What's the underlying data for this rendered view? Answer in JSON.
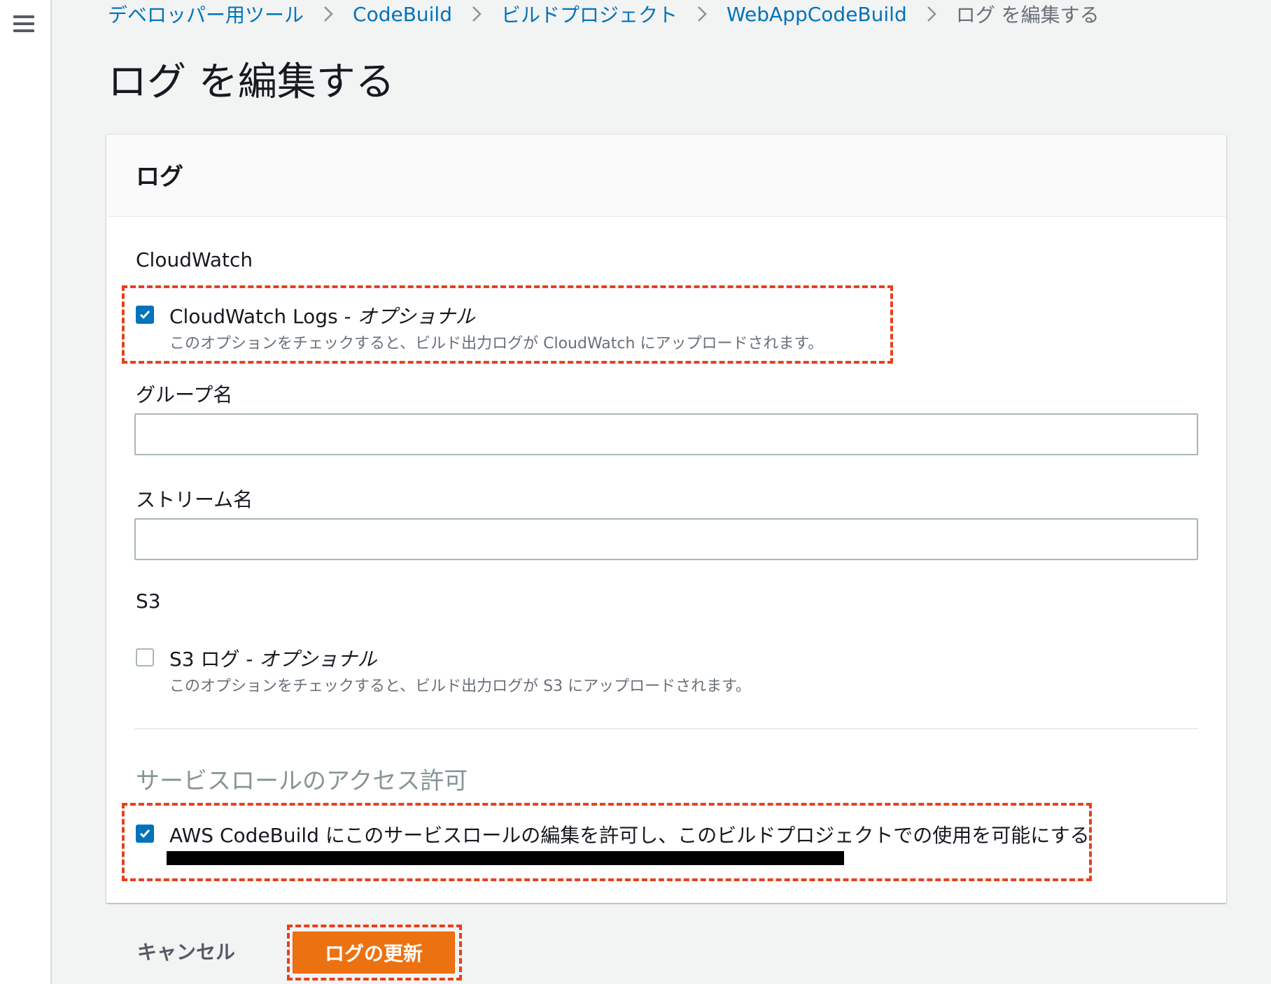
{
  "breadcrumb": [
    {
      "label": "デベロッパー用ツール"
    },
    {
      "label": "CodeBuild"
    },
    {
      "label": "ビルドプロジェクト"
    },
    {
      "label": "WebAppCodeBuild"
    },
    {
      "label": "ログ を編集する"
    }
  ],
  "page_title": "ログ を編集する",
  "panel": {
    "title": "ログ",
    "cloudwatch": {
      "section_label": "CloudWatch",
      "logs_checkbox": {
        "checked": true,
        "label": "CloudWatch Logs -",
        "optional": "オプショナル",
        "description": "このオプションをチェックすると、ビルド出力ログが CloudWatch にアップロードされます。"
      },
      "group_name_label": "グループ名",
      "group_name_value": "",
      "stream_name_label": "ストリーム名",
      "stream_name_value": ""
    },
    "s3": {
      "section_label": "S3",
      "logs_checkbox": {
        "checked": false,
        "label": "S3 ログ -",
        "optional": "オプショナル",
        "description": "このオプションをチェックすると、ビルド出力ログが S3 にアップロードされます。"
      }
    },
    "service_role": {
      "heading": "サービスロールのアクセス許可",
      "checkbox": {
        "checked": true,
        "label": "AWS CodeBuild にこのサービスロールの編集を許可し、このビルドプロジェクトでの使用を可能にする"
      }
    }
  },
  "actions": {
    "cancel_label": "キャンセル",
    "submit_label": "ログの更新"
  },
  "colors": {
    "link": "#0073bb",
    "checkbox": "#0073bb",
    "primary_button": "#ec7211",
    "highlight": "#e8401c"
  }
}
